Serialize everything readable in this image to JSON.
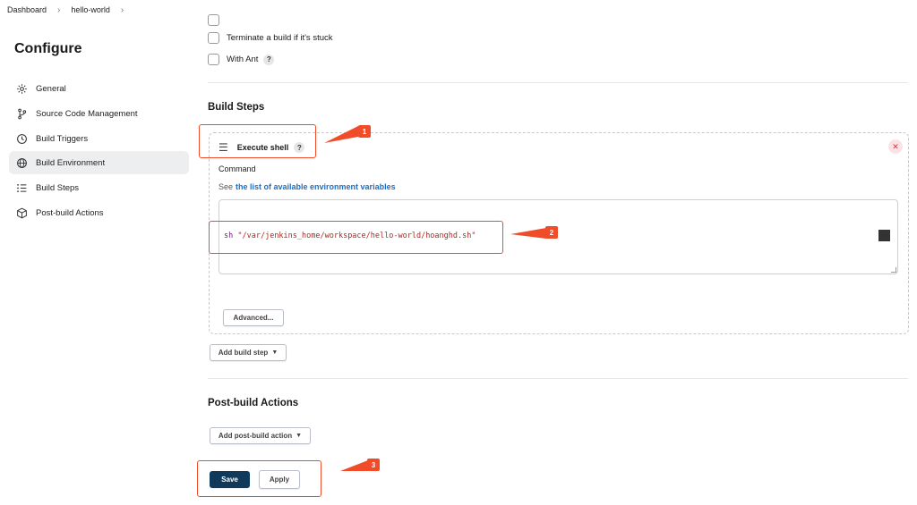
{
  "breadcrumb": {
    "items": [
      "Dashboard",
      "hello-world"
    ]
  },
  "sidebar": {
    "title": "Configure",
    "items": [
      {
        "label": "General",
        "icon": "gear-icon"
      },
      {
        "label": "Source Code Management",
        "icon": "branch-icon"
      },
      {
        "label": "Build Triggers",
        "icon": "clock-icon"
      },
      {
        "label": "Build Environment",
        "icon": "globe-icon",
        "active": true
      },
      {
        "label": "Build Steps",
        "icon": "list-icon"
      },
      {
        "label": "Post-build Actions",
        "icon": "package-icon"
      }
    ]
  },
  "options": {
    "terminate_label": "Terminate a build if it's stuck",
    "with_ant_label": "With Ant",
    "help_glyph": "?"
  },
  "build_steps": {
    "title": "Build Steps",
    "step_title": "Execute shell",
    "command_label": "Command",
    "see_prefix": "See",
    "env_link": "the list of available environment variables",
    "command_keyword": "sh",
    "command_string": "\"/var/jenkins_home/workspace/hello-world/hoanghd.sh\"",
    "advanced_label": "Advanced...",
    "add_step_label": "Add build step"
  },
  "post_build": {
    "title": "Post-build Actions",
    "add_action_label": "Add post-build action"
  },
  "footer": {
    "save_label": "Save",
    "apply_label": "Apply"
  },
  "annotations": [
    "1",
    "2",
    "3"
  ],
  "colors": {
    "annotation": "#f04c2a",
    "primary_button": "#0f3a5c",
    "link": "#1a6fc9"
  }
}
